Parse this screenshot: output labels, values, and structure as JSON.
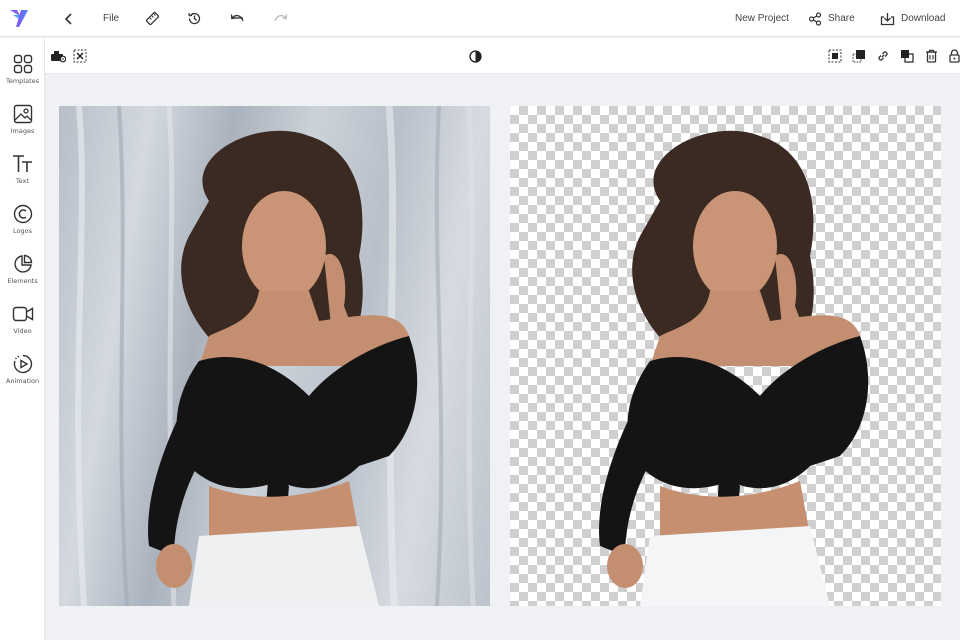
{
  "app": {
    "logo": "app-logo",
    "accent": "#7b5cf5",
    "accent2": "#3fa9f5"
  },
  "topbar": {
    "file_label": "File",
    "new_project_label": "New Project",
    "share_label": "Share",
    "download_label": "Download",
    "icons": [
      "back-arrow-icon",
      "ruler-icon",
      "history-icon",
      "undo-icon",
      "redo-icon",
      "share-icon",
      "download-icon"
    ]
  },
  "subbar": {
    "left_icons": [
      "bg-remove-icon",
      "remove-icon"
    ],
    "center_icon": "contrast-icon",
    "right_icons": [
      "crop-icon",
      "shadow-icon",
      "link-icon",
      "layers-icon",
      "trash-icon",
      "lock-icon"
    ]
  },
  "sidebar": {
    "items": [
      {
        "label": "Templates",
        "icon": "templates-icon"
      },
      {
        "label": "Images",
        "icon": "images-icon"
      },
      {
        "label": "Text",
        "icon": "text-icon"
      },
      {
        "label": "Logos",
        "icon": "logos-icon"
      },
      {
        "label": "Elements",
        "icon": "elements-icon"
      },
      {
        "label": "Video",
        "icon": "video-icon"
      },
      {
        "label": "Animation",
        "icon": "animation-icon"
      }
    ]
  },
  "canvas": {
    "original_image": "portrait-original",
    "processed_image": "portrait-background-removed"
  }
}
